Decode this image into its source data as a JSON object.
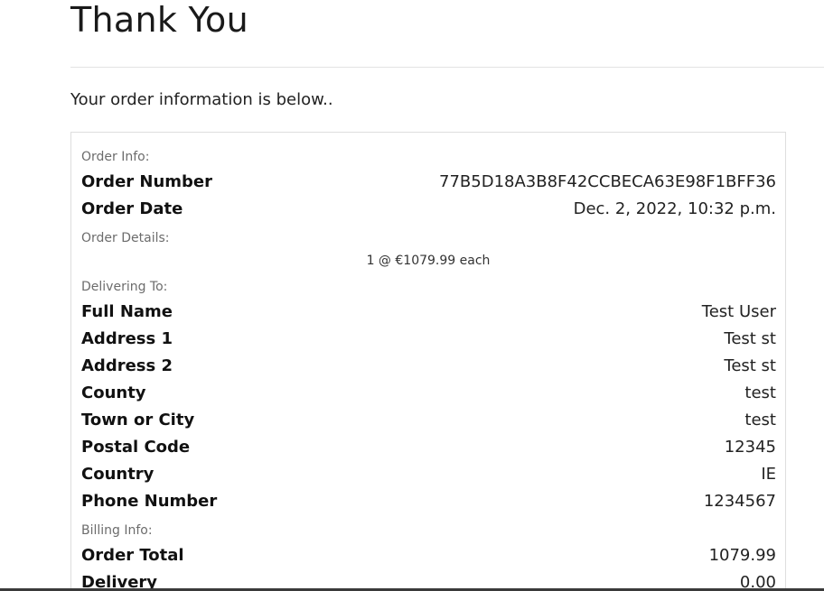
{
  "page": {
    "title": "Thank You",
    "intro": "Your order information is below.."
  },
  "order_info": {
    "section_label": "Order Info:",
    "rows": [
      {
        "key": "Order Number",
        "value": "77B5D18A3B8F42CCBECA63E98F1BFF36"
      },
      {
        "key": "Order Date",
        "value": "Dec. 2, 2022, 10:32 p.m."
      }
    ]
  },
  "order_details": {
    "section_label": "Order Details:",
    "item_line": "1 @ €1079.99 each"
  },
  "delivering_to": {
    "section_label": "Delivering To:",
    "rows": [
      {
        "key": "Full Name",
        "value": "Test User"
      },
      {
        "key": "Address 1",
        "value": "Test st"
      },
      {
        "key": "Address 2",
        "value": "Test st"
      },
      {
        "key": "County",
        "value": "test"
      },
      {
        "key": "Town or City",
        "value": "test"
      },
      {
        "key": "Postal Code",
        "value": "12345"
      },
      {
        "key": "Country",
        "value": "IE"
      },
      {
        "key": "Phone Number",
        "value": "1234567"
      }
    ]
  },
  "billing_info": {
    "section_label": "Billing Info:",
    "rows": [
      {
        "key": "Order Total",
        "value": "1079.99"
      },
      {
        "key": "Delivery",
        "value": "0.00"
      }
    ]
  }
}
